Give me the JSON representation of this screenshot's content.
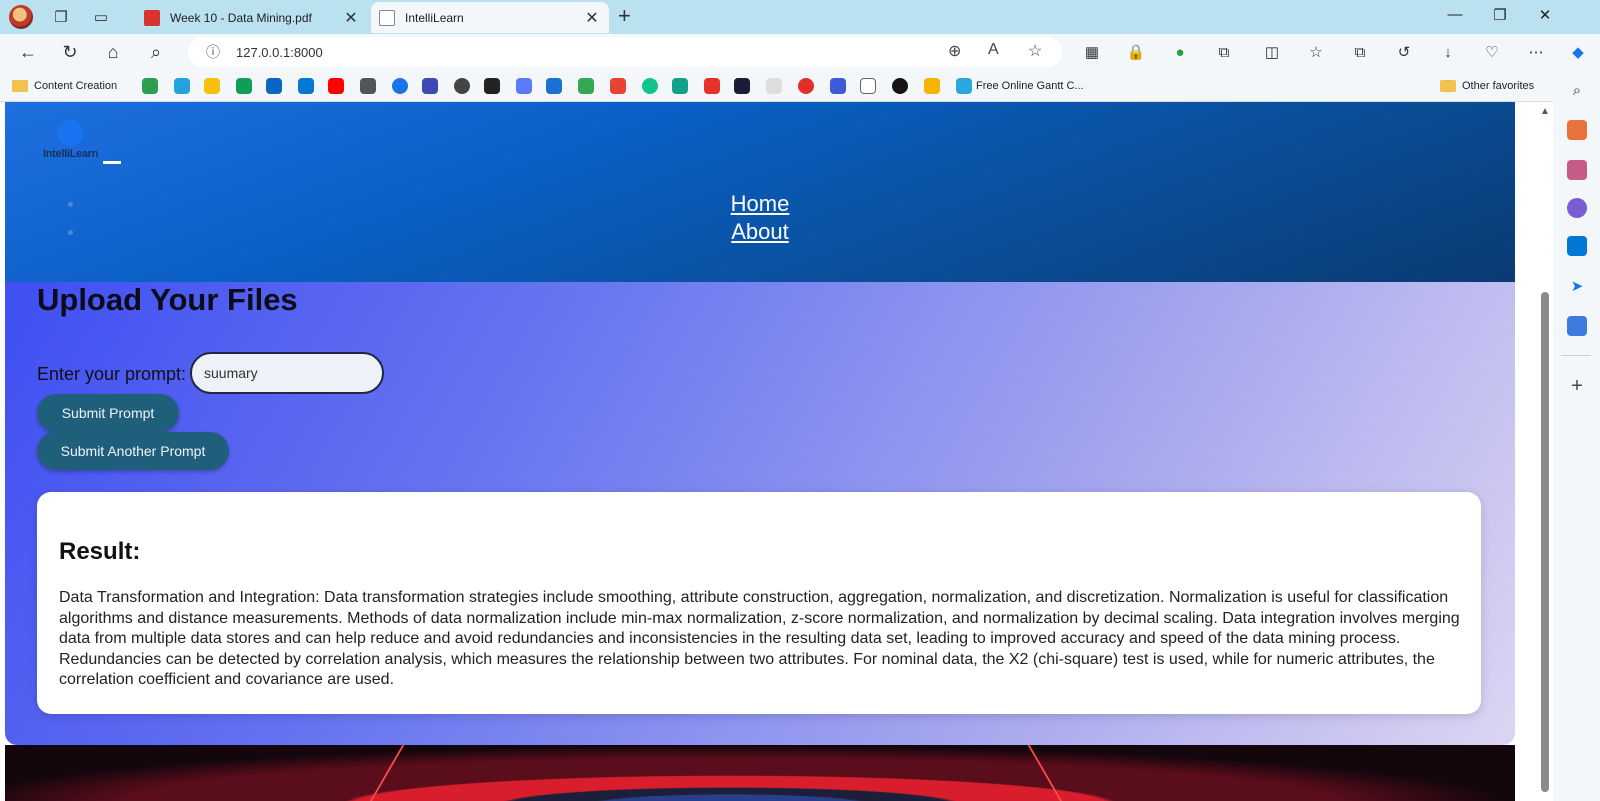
{
  "browser": {
    "tabs": [
      {
        "title": "Week 10 - Data Mining.pdf",
        "active": false
      },
      {
        "title": "IntelliLearn",
        "active": true
      }
    ],
    "url": "127.0.0.1:8000",
    "bookmarks": {
      "first": "Content Creation",
      "gantt": "Free Online Gantt C...",
      "other": "Other favorites"
    }
  },
  "site": {
    "logo_text": "IntelliLearn",
    "nav": {
      "home": "Home",
      "about": "About"
    }
  },
  "upload": {
    "title": "Upload Your Files",
    "prompt_label": "Enter your prompt:",
    "prompt_value": "suumary",
    "submit_label": "Submit Prompt",
    "submit_another_label": "Submit Another Prompt"
  },
  "result": {
    "heading": "Result:",
    "text": "Data Transformation and Integration: Data transformation strategies include smoothing, attribute construction, aggregation, normalization, and discretization. Normalization is useful for classification algorithms and distance measurements. Methods of data normalization include min-max normalization, z-score normalization, and normalization by decimal scaling. Data integration involves merging data from multiple data stores and can help reduce and avoid redundancies and inconsistencies in the resulting data set, leading to improved accuracy and speed of the data mining process. Redundancies can be detected by correlation analysis, which measures the relationship between two attributes. For nominal data, the X2 (chi-square) test is used, while for numeric attributes, the correlation coefficient and covariance are used."
  },
  "colors": {
    "header": "#0a4d96",
    "button": "#1f5f7c",
    "chrome_tabbar": "#b9e1ef"
  }
}
